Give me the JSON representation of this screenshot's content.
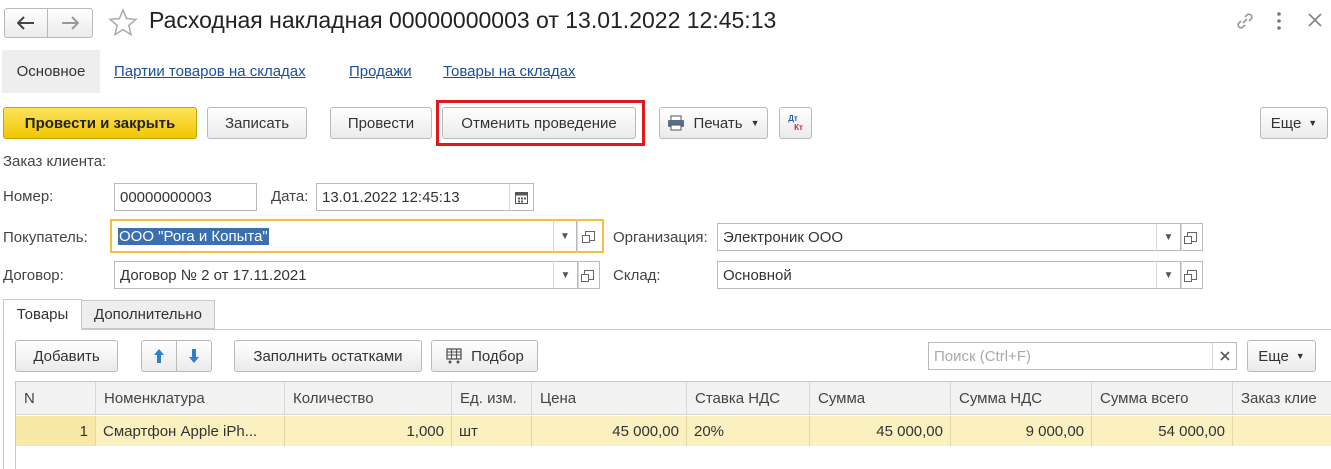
{
  "window": {
    "title": "Расходная накладная 00000000003 от 13.01.2022 12:45:13"
  },
  "nav": {
    "tabs": [
      "Основное",
      "Партии товаров на складах",
      "Продажи",
      "Товары на складах"
    ]
  },
  "toolbar": {
    "post_close": "Провести и закрыть",
    "save": "Записать",
    "post": "Провести",
    "unpost": "Отменить проведение",
    "print": "Печать",
    "dtkt_top": "Дт",
    "dtkt_bottom": "Кт",
    "more": "Еще"
  },
  "form": {
    "order_label": "Заказ клиента:",
    "number_label": "Номер:",
    "number_value": "00000000003",
    "date_label": "Дата:",
    "date_value": "13.01.2022 12:45:13",
    "buyer_label": "Покупатель:",
    "buyer_value": "ООО \"Рога и Копыта\"",
    "org_label": "Организация:",
    "org_value": "Электроник ООО",
    "contract_label": "Договор:",
    "contract_value": "Договор № 2 от 17.11.2021",
    "warehouse_label": "Склад:",
    "warehouse_value": "Основной"
  },
  "tabs": {
    "goods": "Товары",
    "extra": "Дополнительно"
  },
  "table_toolbar": {
    "add": "Добавить",
    "fill": "Заполнить остатками",
    "select": "Подбор",
    "search_placeholder": "Поиск (Ctrl+F)",
    "more": "Еще"
  },
  "table": {
    "headers": [
      "N",
      "Номенклатура",
      "Количество",
      "Ед. изм.",
      "Цена",
      "Ставка НДС",
      "Сумма",
      "Сумма НДС",
      "Сумма всего",
      "Заказ клие"
    ],
    "rows": [
      [
        "1",
        "Смартфон Apple iPh...",
        "1,000",
        "шт",
        "45 000,00",
        "20%",
        "45 000,00",
        "9 000,00",
        "54 000,00",
        ""
      ]
    ]
  },
  "colors": {
    "primary_button": "#f2c600",
    "highlight_border": "#e0191c",
    "focus_border": "#f0c040",
    "selected_row": "#fbf0c0",
    "link": "#1a4f9c"
  }
}
